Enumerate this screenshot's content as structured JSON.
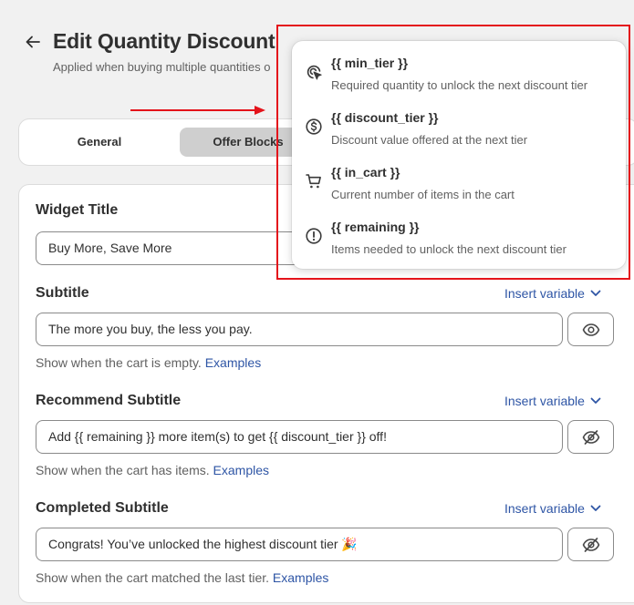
{
  "header": {
    "title": "Edit Quantity Discount",
    "subtitle": "Applied when buying multiple quantities o"
  },
  "tabs": [
    {
      "label": "General"
    },
    {
      "label": "Offer Blocks"
    }
  ],
  "widget_title": {
    "label": "Widget Title",
    "value": "Buy More, Save More"
  },
  "subtitle": {
    "label": "Subtitle",
    "insert_label": "Insert variable",
    "value": "The more you buy, the less you pay.",
    "helper": "Show when the cart is empty.",
    "link": "Examples"
  },
  "recommend_subtitle": {
    "label": "Recommend Subtitle",
    "insert_label": "Insert variable",
    "value": "Add {{ remaining }} more item(s) to get {{ discount_tier }} off!",
    "helper": "Show when the cart has items.",
    "link": "Examples"
  },
  "completed_subtitle": {
    "label": "Completed Subtitle",
    "insert_label": "Insert variable",
    "value": "Congrats! You’ve unlocked the highest discount tier 🎉",
    "helper": "Show when the cart matched the last tier.",
    "link": "Examples"
  },
  "variables": [
    {
      "name": "{{ min_tier }}",
      "desc": "Required quantity to unlock the next discount tier",
      "icon": "cursor-target-icon"
    },
    {
      "name": "{{ discount_tier }}",
      "desc": "Discount value offered at the next tier",
      "icon": "dollar-circle-icon"
    },
    {
      "name": "{{ in_cart }}",
      "desc": "Current number of items in the cart",
      "icon": "cart-icon"
    },
    {
      "name": "{{ remaining }}",
      "desc": "Items needed to unlock the next discount tier",
      "icon": "alert-circle-icon"
    }
  ],
  "colors": {
    "link": "#2e55a5",
    "annotation": "#e4131b",
    "active_tab": "#cfcfcf"
  }
}
